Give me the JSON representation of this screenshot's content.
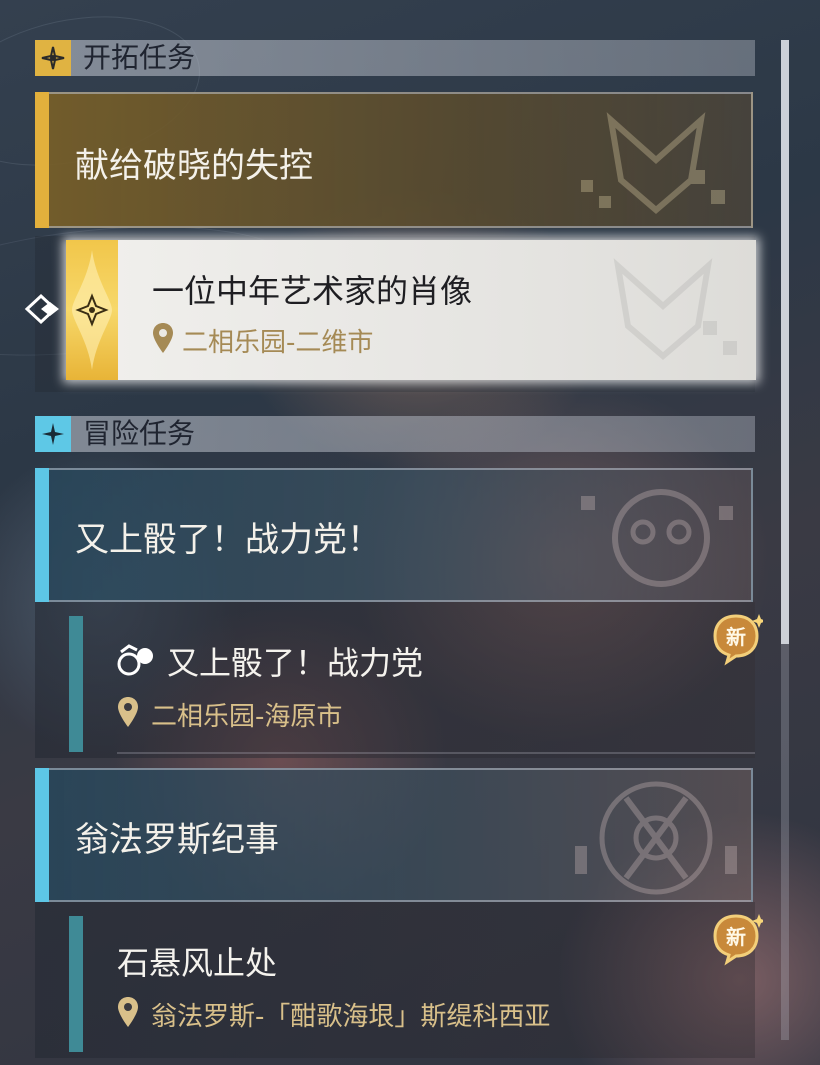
{
  "trailblaze_section": {
    "title": "开拓任务",
    "icon": "trailblaze-star-icon",
    "color": "#e0b342"
  },
  "adventure_section": {
    "title": "冒险任务",
    "icon": "adventure-star-icon",
    "color": "#5ec8e6"
  },
  "quests": {
    "main1": {
      "title": "献给破晓的失控"
    },
    "main1_sub": {
      "title": "一位中年艺术家的肖像",
      "location": "二相乐园-二维市"
    },
    "adv1": {
      "title": "又上骰了！战力党！"
    },
    "adv1_sub": {
      "title": "又上骰了！战力党",
      "location": "二相乐园-海原市",
      "badge": "新"
    },
    "adv2": {
      "title": "翁法罗斯纪事"
    },
    "adv2_sub": {
      "title": "石悬风止处",
      "location": "翁法罗斯-「酣歌海垠」斯缇科西亚",
      "badge": "新"
    }
  }
}
